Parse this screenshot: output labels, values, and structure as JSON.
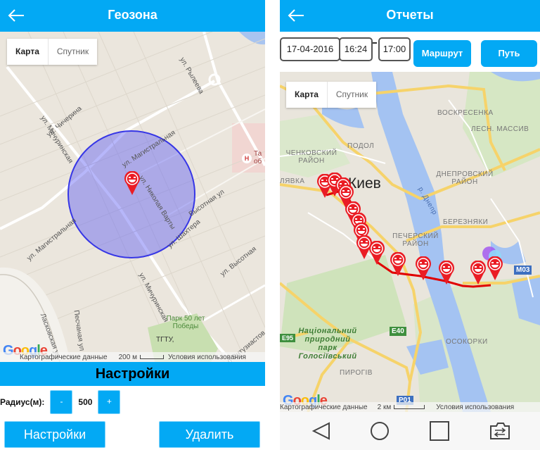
{
  "left_screen": {
    "header": {
      "title": "Геозона",
      "back_icon": "arrow-left-icon"
    },
    "map": {
      "map_type": {
        "map_label": "Карта",
        "satellite_label": "Спутник",
        "selected": "Карта"
      },
      "streets": [
        "ул. Рылеева",
        "ул. Чичерина",
        "ул. Мичуринская",
        "ул. Магистральная",
        "ул. Николая Варты",
        "Высотная ул",
        "ул. Шахтера",
        "ул. Высотная",
        "ул. Магистральная",
        "Ласковская ул",
        "Песчаная ул",
        "ул. Мичуринская",
        "б-р Энтузиастов"
      ],
      "poi": {
        "park": "Парк 50 лет Победы",
        "university": "ТГТУ,",
        "hospital": "Та об"
      },
      "geofence": {
        "color": "#3f3fe8",
        "fill": "rgba(90,90,240,0.45)"
      },
      "marker_icon": "smiley-pin-icon",
      "attribution": {
        "logo": "Google",
        "data": "Картографические данные",
        "scale": "200 м",
        "terms": "Условия использования"
      }
    },
    "settings_header": "Настройки",
    "radius": {
      "label": "Радиус(м):",
      "minus": "-",
      "value": "500",
      "plus": "+"
    },
    "buttons": {
      "settings": "Настройки",
      "delete": "Удалить"
    }
  },
  "right_screen": {
    "header": {
      "title": "Отчеты",
      "back_icon": "arrow-left-icon"
    },
    "filters": {
      "date": "17-04-2016",
      "time_from": "16:24",
      "time_to": "17:00",
      "route_button": "Маршрут",
      "path_button": "Путь"
    },
    "map": {
      "map_type": {
        "map_label": "Карта",
        "satellite_label": "Спутник",
        "selected": "Карта"
      },
      "city_label": "Киев",
      "districts": [
        "ВОСКРЕСЕНКА",
        "ЛЕСН. МАССИВ",
        "ПОДОЛ",
        "ЧЕНКОВСКИЙ РАЙОН",
        "ДНЕПРОВСКИЙ РАЙОН",
        "ПЕЧЕРСКИЙ РАЙОН",
        "БЕРЕЗНЯКИ",
        "ОСОКОРКИ",
        "ПИРОГІВ",
        "ЛЯВКА"
      ],
      "river_label": "р. Днепр",
      "park_label": "Національний природний парк Голосіївський",
      "road_shields": [
        "M03",
        "E40",
        "P01",
        "E95"
      ],
      "route_color": "#e00000",
      "marker_count": 14,
      "marker_icon": "smiley-pin-icon",
      "attribution": {
        "logo": "Google",
        "data": "Картографические данные",
        "scale": "2 км",
        "terms": "Условия использования"
      }
    },
    "navbar": {
      "back": "nav-back-icon",
      "home": "nav-home-icon",
      "recents": "nav-recents-icon",
      "switch": "nav-switch-icon"
    }
  }
}
